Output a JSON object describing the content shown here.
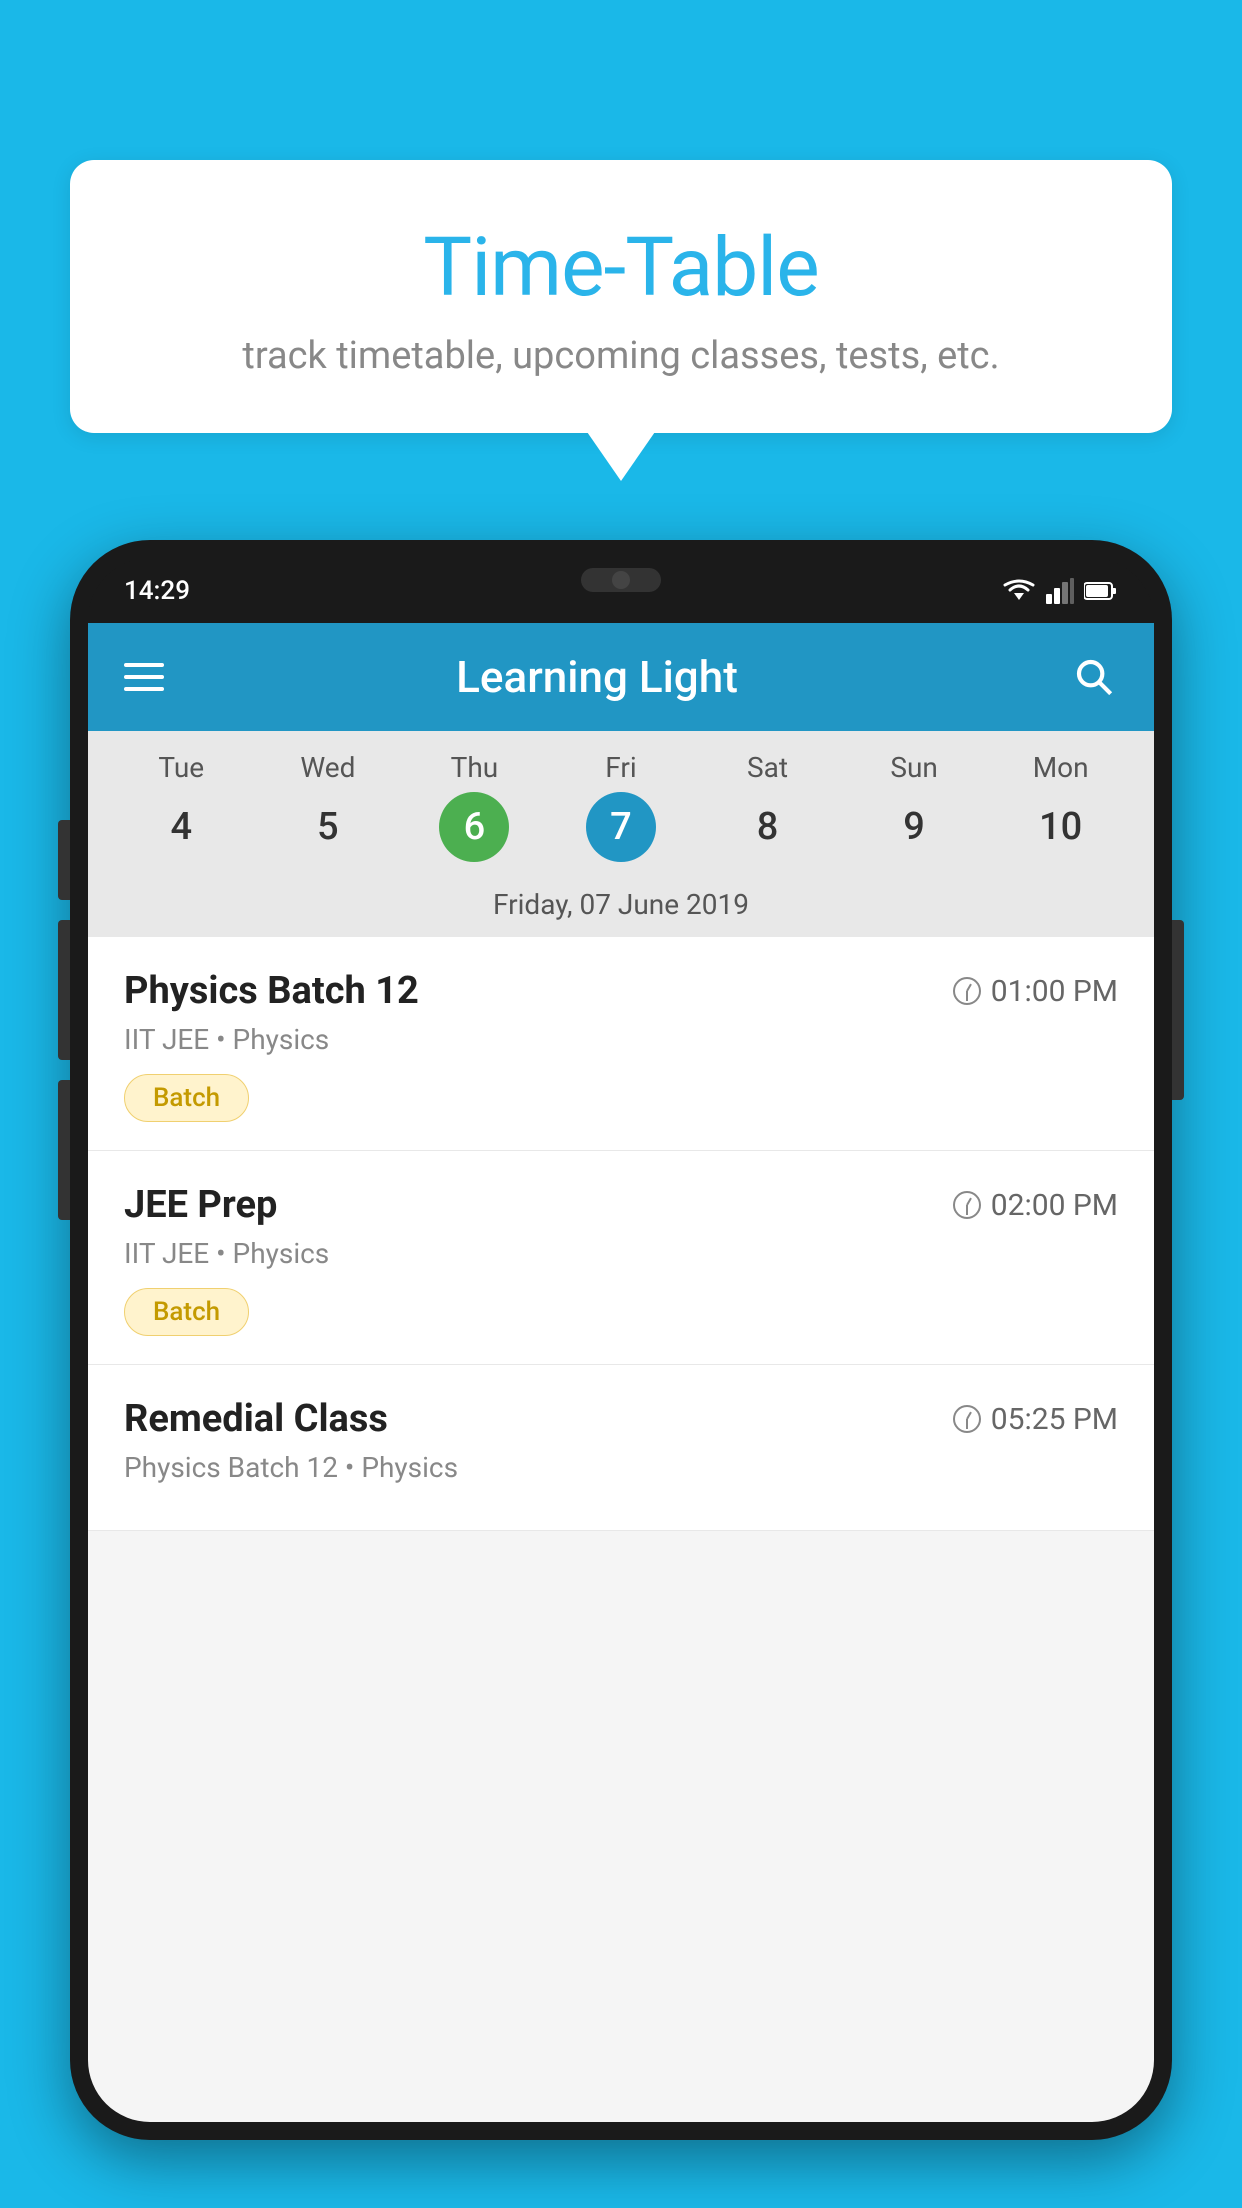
{
  "bubble": {
    "title": "Time-Table",
    "subtitle": "track timetable, upcoming classes, tests, etc."
  },
  "phone": {
    "status_bar": {
      "time": "14:29"
    },
    "header": {
      "app_title": "Learning Light"
    },
    "calendar": {
      "days": [
        "Tue",
        "Wed",
        "Thu",
        "Fri",
        "Sat",
        "Sun",
        "Mon"
      ],
      "dates": [
        "4",
        "5",
        "6",
        "7",
        "8",
        "9",
        "10"
      ],
      "today_index": 2,
      "selected_index": 3,
      "selected_date_label": "Friday, 07 June 2019"
    },
    "schedule": [
      {
        "name": "Physics Batch 12",
        "time": "01:00 PM",
        "meta": "IIT JEE • Physics",
        "badge": "Batch"
      },
      {
        "name": "JEE Prep",
        "time": "02:00 PM",
        "meta": "IIT JEE • Physics",
        "badge": "Batch"
      },
      {
        "name": "Remedial Class",
        "time": "05:25 PM",
        "meta": "Physics Batch 12 • Physics",
        "badge": null
      }
    ]
  },
  "icons": {
    "hamburger": "≡",
    "search": "search",
    "clock": "clock"
  }
}
